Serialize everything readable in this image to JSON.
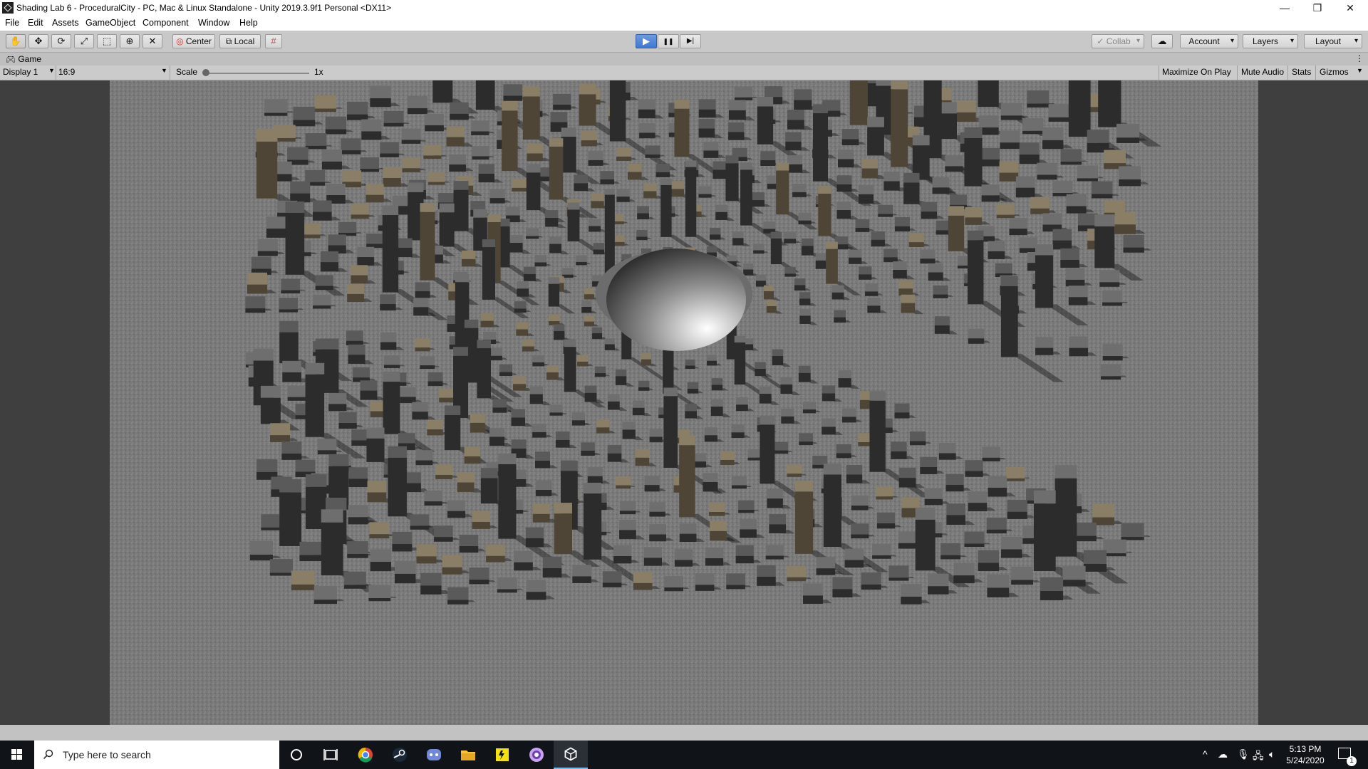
{
  "window": {
    "title": "Shading Lab 6 - ProceduralCity - PC, Mac & Linux Standalone - Unity 2019.3.9f1 Personal <DX11>",
    "minimize": "—",
    "restore": "❐",
    "close": "✕"
  },
  "menu": [
    "File",
    "Edit",
    "Assets",
    "GameObject",
    "Component",
    "Window",
    "Help"
  ],
  "toolbar": {
    "tools": [
      "hand-tool-icon",
      "move-tool-icon",
      "rotate-tool-icon",
      "scale-tool-icon",
      "rect-tool-icon",
      "transform-tool-icon",
      "custom-tool-icon"
    ],
    "pivot_label": "Center",
    "space_label": "Local",
    "play_icon": "▶",
    "pause_icon": "❚❚",
    "step_icon": "▶|",
    "collab_label": "Collab",
    "account_label": "Account",
    "layers_label": "Layers",
    "layout_label": "Layout"
  },
  "game_tab": {
    "label": "Game",
    "menu_icon": "⋮"
  },
  "game_bar": {
    "display": "Display 1",
    "aspect": "16:9",
    "scale_label": "Scale",
    "scale_value": "1x",
    "maximize_on_play": "Maximize On Play",
    "mute_audio": "Mute Audio",
    "stats": "Stats",
    "gizmos": "Gizmos"
  },
  "taskbar": {
    "search_placeholder": "Type here to search",
    "apps": [
      "cortana-icon",
      "task-view-icon",
      "chrome-icon",
      "steam-icon",
      "discord-icon",
      "file-explorer-icon",
      "sticky-app-icon",
      "purple-app-icon",
      "unity-icon"
    ],
    "time": "5:13 PM",
    "date": "5/24/2020",
    "notification_count": "1"
  }
}
